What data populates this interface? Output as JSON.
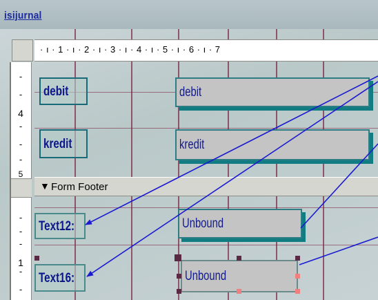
{
  "window": {
    "title": "isijurnal"
  },
  "ruler": {
    "marks": "· ı · 1 · ı · 2 · ı · 3 · ı · 4 · ı · 5 · ı · 6 · ı · 7"
  },
  "vertical_ruler": {
    "label_4": "4",
    "label_5": "5",
    "label_1": "1"
  },
  "detail_section": {
    "fields": [
      {
        "label": "debit",
        "value": "debit"
      },
      {
        "label": "kredit",
        "value": "kredit"
      }
    ]
  },
  "form_footer": {
    "section_label": "Form Footer",
    "arrow_icon": "section-down-arrow-icon",
    "controls": [
      {
        "label": "Text12:",
        "value": "Unbound"
      },
      {
        "label": "Text16:",
        "value": "Unbound"
      }
    ]
  },
  "colors": {
    "label_text": "#0b168c",
    "textbox_bg": "#c4c4c4",
    "annotation_arrow": "#1a1ad0"
  }
}
